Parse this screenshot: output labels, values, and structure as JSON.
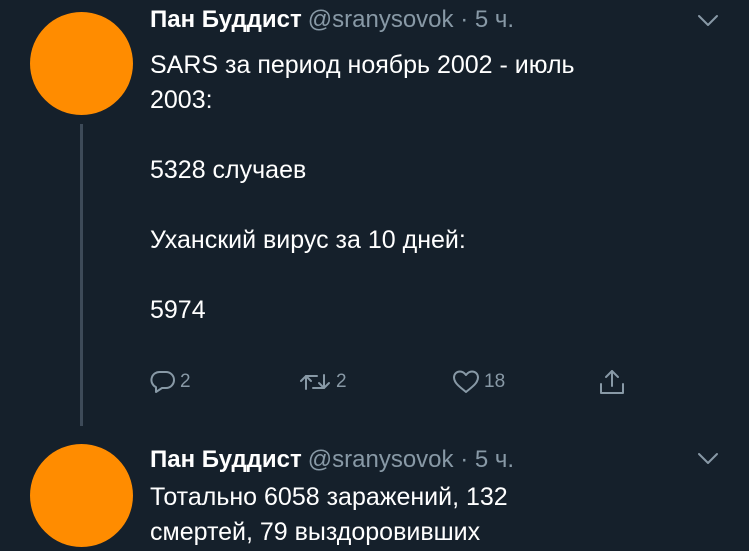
{
  "tweets": [
    {
      "author_name": "Пан Буддист",
      "handle": "@sranysovok",
      "separator": "·",
      "time": "5 ч.",
      "lines": [
        "SARS за период ноябрь 2002 - июль",
        "2003:",
        "",
        "5328 случаев",
        "",
        "Уханский вирус за 10 дней:",
        "",
        "5974"
      ],
      "replies": "2",
      "retweets": "2",
      "likes": "18"
    },
    {
      "author_name": "Пан Буддист",
      "handle": "@sranysovok",
      "separator": "·",
      "time": "5 ч.",
      "lines": [
        "Тотально 6058 заражений, 132",
        "смертей, 79 выздоровивших"
      ]
    }
  ],
  "colors": {
    "background": "#15202b",
    "avatar": "#ff8c00",
    "secondary_text": "#8899a6",
    "thread_line": "#3d4a58"
  },
  "icons": [
    "chevron-down-icon",
    "reply-icon",
    "retweet-icon",
    "like-icon",
    "share-icon"
  ]
}
